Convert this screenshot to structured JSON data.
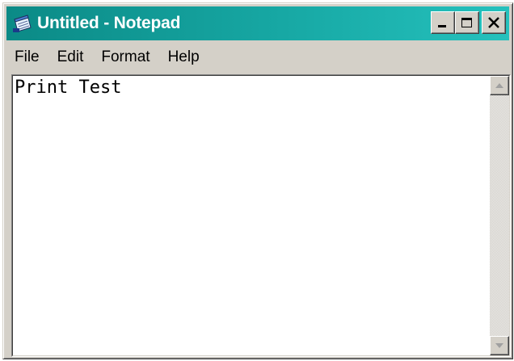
{
  "window": {
    "title": "Untitled - Notepad",
    "titlebar_color": "#17a8a4",
    "icon": "notepad-icon"
  },
  "title_buttons": [
    {
      "name": "minimize-button",
      "icon": "minimize-icon"
    },
    {
      "name": "maximize-button",
      "icon": "maximize-icon"
    },
    {
      "name": "close-button",
      "icon": "close-icon"
    }
  ],
  "menu": {
    "items": [
      {
        "label": "File"
      },
      {
        "label": "Edit"
      },
      {
        "label": "Format"
      },
      {
        "label": "Help"
      }
    ]
  },
  "editor": {
    "content": "Print Test"
  },
  "scrollbar": {
    "up_icon": "scroll-up-arrow-icon",
    "down_icon": "scroll-down-arrow-icon"
  }
}
